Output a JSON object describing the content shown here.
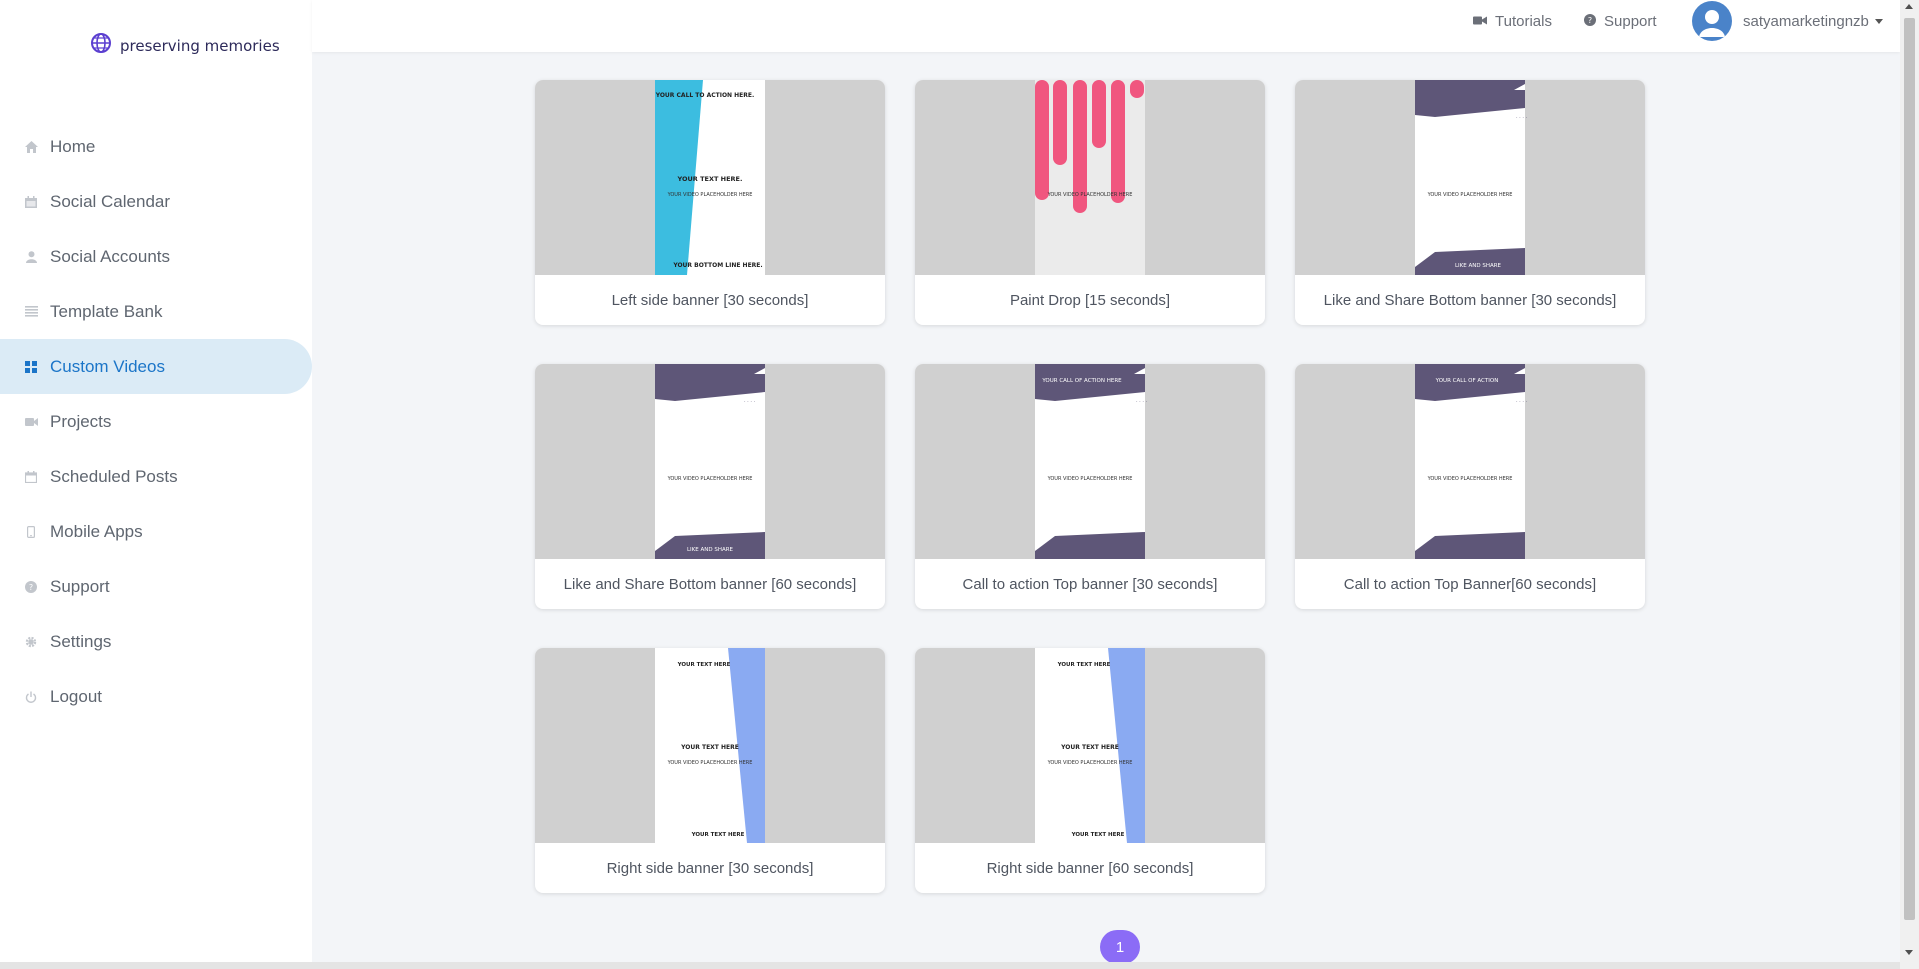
{
  "brand": {
    "name": "preserving memories"
  },
  "sidebar": {
    "items": [
      {
        "label": "Home",
        "icon": "home-icon"
      },
      {
        "label": "Social Calendar",
        "icon": "calendar-icon"
      },
      {
        "label": "Social Accounts",
        "icon": "user-icon"
      },
      {
        "label": "Template Bank",
        "icon": "list-icon"
      },
      {
        "label": "Custom Videos",
        "icon": "grid-icon"
      },
      {
        "label": "Projects",
        "icon": "video-icon"
      },
      {
        "label": "Scheduled Posts",
        "icon": "calendar-icon"
      },
      {
        "label": "Mobile Apps",
        "icon": "mobile-icon"
      },
      {
        "label": "Support",
        "icon": "help-icon"
      },
      {
        "label": "Settings",
        "icon": "gear-icon"
      },
      {
        "label": "Logout",
        "icon": "power-icon"
      }
    ],
    "active_index": 4
  },
  "header": {
    "tutorials_label": "Tutorials",
    "support_label": "Support",
    "username": "satyamarketingnzb"
  },
  "cards": [
    {
      "title": "Left side banner [30 seconds]",
      "thumb": {
        "top": "YOUR CALL TO ACTION HERE.",
        "middle": "YOUR TEXT HERE.",
        "placeholder": "YOUR VIDEO PLACEHOLDER HERE",
        "bottom": "YOUR BOTTOM LINE HERE."
      }
    },
    {
      "title": "Paint Drop [15 seconds]",
      "thumb": {
        "placeholder": "YOUR VIDEO PLACEHOLDER HERE"
      }
    },
    {
      "title": "Like and Share Bottom banner [30 seconds]",
      "thumb": {
        "placeholder": "YOUR VIDEO PLACEHOLDER HERE",
        "bottom": "LIKE AND SHARE"
      }
    },
    {
      "title": "Like and Share Bottom banner [60 seconds]",
      "thumb": {
        "placeholder": "YOUR VIDEO PLACEHOLDER HERE",
        "bottom": "LIKE AND SHARE"
      }
    },
    {
      "title": "Call to action Top banner [30 seconds]",
      "thumb": {
        "top": "YOUR CALL OF ACTION HERE",
        "placeholder": "YOUR VIDEO PLACEHOLDER HERE"
      }
    },
    {
      "title": "Call to action Top Banner[60 seconds]",
      "thumb": {
        "top": "YOUR CALL OF ACTION",
        "placeholder": "YOUR VIDEO PLACEHOLDER HERE"
      }
    },
    {
      "title": "Right side banner [30 seconds]",
      "thumb": {
        "top": "YOUR TEXT HERE",
        "middle": "YOUR TEXT HERE",
        "placeholder": "YOUR VIDEO PLACEHOLDER HERE",
        "bottom": "YOUR TEXT HERE"
      }
    },
    {
      "title": "Right side banner [60 seconds]",
      "thumb": {
        "top": "YOUR TEXT HERE",
        "middle": "YOUR TEXT HERE",
        "placeholder": "YOUR VIDEO PLACEHOLDER HERE",
        "bottom": "YOUR TEXT HERE"
      }
    }
  ],
  "pagination": {
    "current_page": "1"
  },
  "colors": {
    "accent": "#1b75c8",
    "active_bg": "#dbebf6",
    "banner_dark": "#5e5678",
    "cyan": "#3cbde0",
    "pink": "#f0567f",
    "blue_strip": "#8aaaf2",
    "pager": "#8b6cf6"
  }
}
